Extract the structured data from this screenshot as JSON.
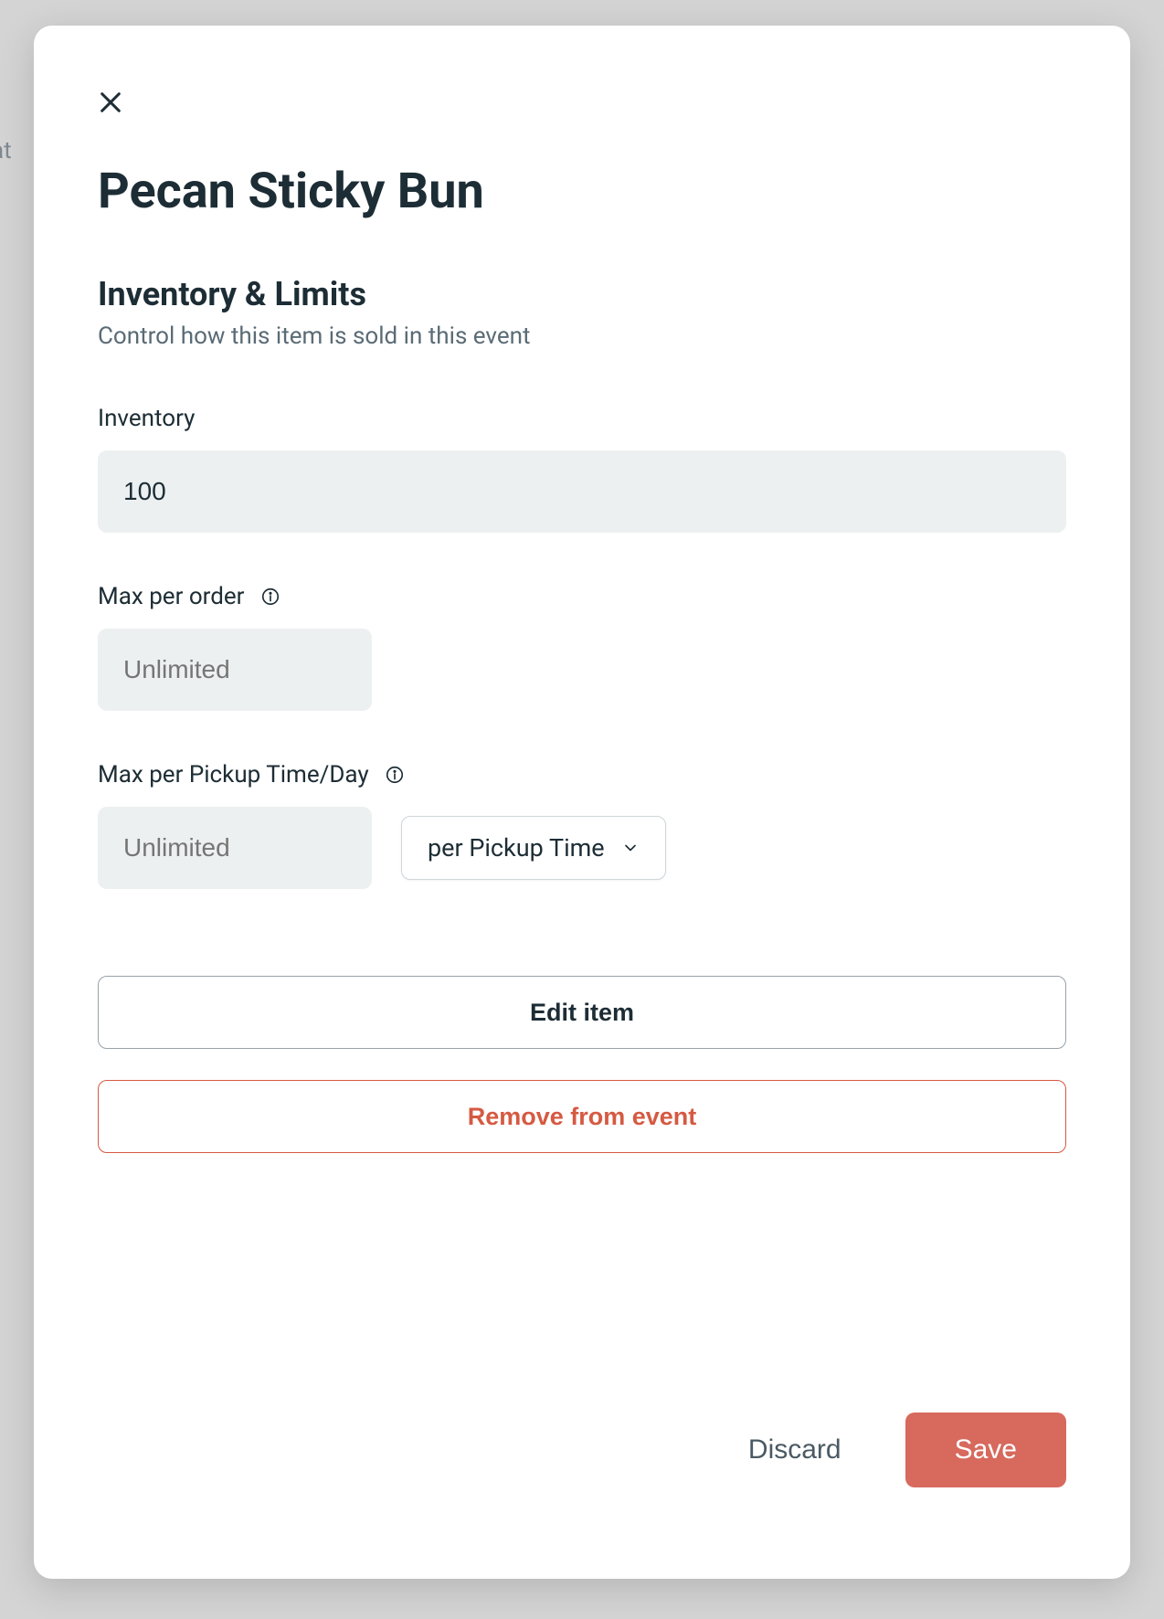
{
  "modal": {
    "title": "Pecan Sticky Bun",
    "section": {
      "heading": "Inventory & Limits",
      "subheading": "Control how this item is sold in this event"
    },
    "fields": {
      "inventory": {
        "label": "Inventory",
        "value": "100"
      },
      "maxPerOrder": {
        "label": "Max per order",
        "value": "",
        "placeholder": "Unlimited"
      },
      "maxPerPickup": {
        "label": "Max per Pickup Time/Day",
        "value": "",
        "placeholder": "Unlimited",
        "select": "per Pickup Time"
      }
    },
    "actions": {
      "edit": "Edit item",
      "remove": "Remove from event"
    },
    "footer": {
      "discard": "Discard",
      "save": "Save"
    }
  },
  "background": {
    "partialText": "at"
  }
}
